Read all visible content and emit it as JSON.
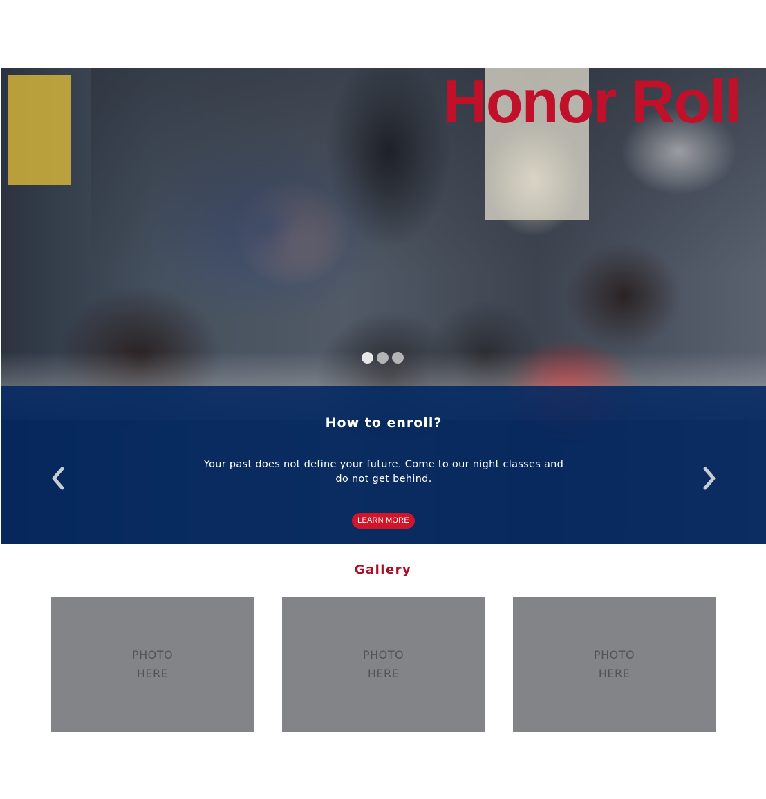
{
  "hero": {
    "title": "Honor Roll",
    "image_alt": "Teacher helping students in a classroom",
    "carousel": {
      "slide_count": 3,
      "active_index": 0
    },
    "overlay": {
      "heading": "How to enroll?",
      "body": "Your past does not define your future. Come to our night classes and do not get behind.",
      "button_label": "LEARN MORE"
    },
    "prev_icon": "chevron-left-icon",
    "next_icon": "chevron-right-icon"
  },
  "gallery": {
    "title": "Gallery",
    "photos": [
      {
        "label": "PHOTO\nHERE"
      },
      {
        "label": "PHOTO\nHERE"
      },
      {
        "label": "PHOTO\nHERE"
      }
    ]
  },
  "colors": {
    "brand_red": "#c0102a",
    "overlay_blue": "#002660",
    "button_red": "#d0162a",
    "placeholder_gray": "#838488"
  }
}
